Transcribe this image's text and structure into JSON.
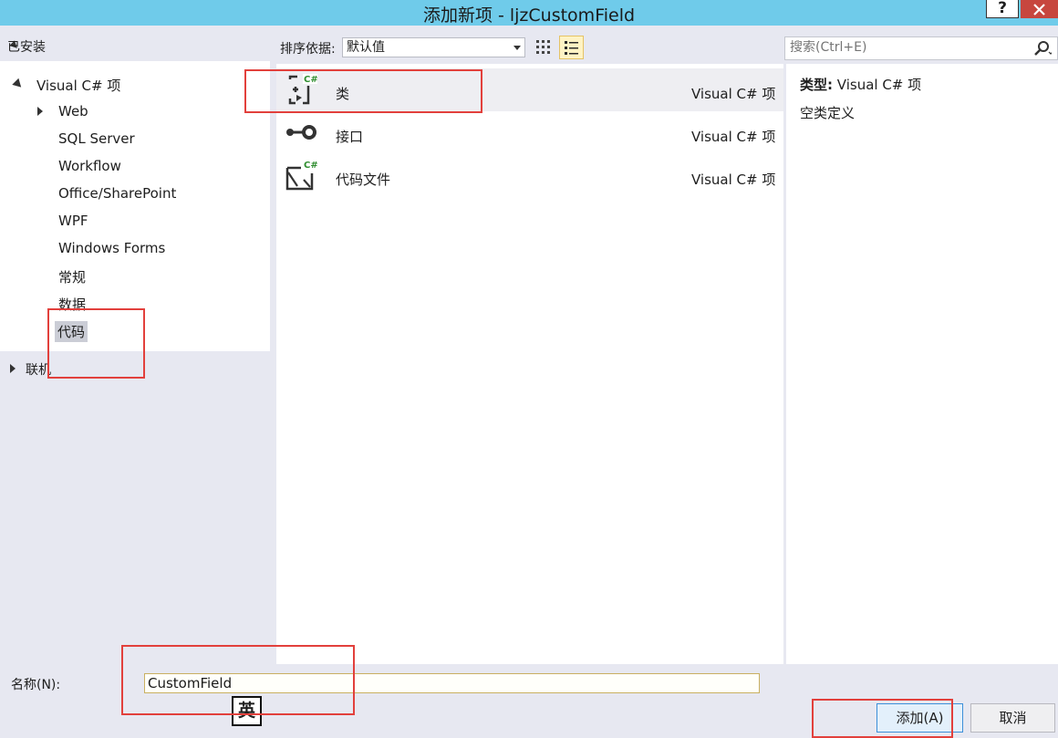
{
  "window": {
    "title": "添加新项 - ljzCustomField",
    "help_label": "?"
  },
  "tree": {
    "installed_header": "已安装",
    "root_label": "Visual C# 项",
    "items": [
      "Web",
      "SQL Server",
      "Workflow",
      "Office/SharePoint",
      "WPF",
      "Windows Forms",
      "常规",
      "数据",
      "代码"
    ],
    "selected": "代码",
    "online_label": "联机"
  },
  "toolbar": {
    "sort_label": "排序依据:",
    "sort_value": "默认值",
    "view_mode": "list"
  },
  "search": {
    "placeholder": "搜索(Ctrl+E)"
  },
  "templates": [
    {
      "name": "类",
      "lang": "Visual C# 项",
      "icon": "class-icon",
      "selected": true
    },
    {
      "name": "接口",
      "lang": "Visual C# 项",
      "icon": "interface-icon",
      "selected": false
    },
    {
      "name": "代码文件",
      "lang": "Visual C# 项",
      "icon": "code-file-icon",
      "selected": false
    }
  ],
  "details": {
    "type_label": "类型:",
    "type_value": "Visual C# 项",
    "description": "空类定义"
  },
  "form": {
    "name_label": "名称(N):",
    "name_value": "CustomField",
    "ime_indicator": "英"
  },
  "buttons": {
    "add": "添加(A)",
    "cancel": "取消"
  },
  "colors": {
    "titlebar": "#6fcbea",
    "close": "#c7463e",
    "annotation": "#e2403c",
    "csharp_badge": "#2f8d2f"
  }
}
